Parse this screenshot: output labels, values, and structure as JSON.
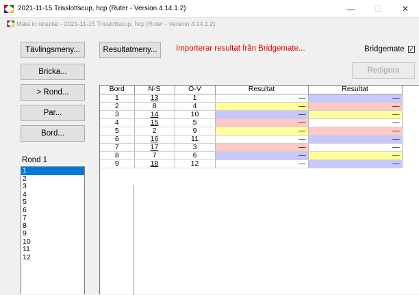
{
  "window": {
    "title": "2021-11-15  Trisslottscup, hcp  (Ruter - Version 4.14.1.2)",
    "minimize_glyph": "—",
    "maximize_glyph": "☐",
    "close_glyph": "✕"
  },
  "subwindow": {
    "title": "Mata in resultat - 2021-11-15  Trisslottscup, hcp  (Ruter - Version 4.14.1.2)"
  },
  "sidebar": {
    "buttons": [
      {
        "label": "Tävlingsmeny..."
      },
      {
        "label": "Bricka..."
      },
      {
        "label": ">   Rond..."
      },
      {
        "label": "Par..."
      },
      {
        "label": "Bord..."
      }
    ],
    "rond_label": "Rond 1",
    "rond_items": [
      "1",
      "2",
      "3",
      "4",
      "5",
      "6",
      "7",
      "8",
      "9",
      "10",
      "11",
      "12"
    ],
    "selected_rond": "1"
  },
  "toolbar": {
    "resultatmeny_label": "Resultatmeny...",
    "import_status": "Importerar resultat från Bridgemate...",
    "bridgemate_label": "Bridgemate",
    "bridgemate_checked": true,
    "bridgemate_check_glyph": "✓",
    "redigera_label": "Redigera"
  },
  "table": {
    "headers": [
      "Bord",
      "N-S",
      "Ö-V",
      "Resultat",
      "Resultat"
    ],
    "rows": [
      {
        "bord": "1",
        "ns": "13",
        "ov": "1",
        "r1": "—",
        "r2": "—",
        "c1": "white",
        "c2": "blue"
      },
      {
        "bord": "2",
        "ns": "8",
        "ov": "4",
        "r1": "—",
        "r2": "—",
        "c1": "yellow",
        "c2": "pink"
      },
      {
        "bord": "3",
        "ns": "14",
        "ov": "10",
        "r1": "—",
        "r2": "—",
        "c1": "blue",
        "c2": "yellow"
      },
      {
        "bord": "4",
        "ns": "15",
        "ov": "5",
        "r1": "—",
        "r2": "—",
        "c1": "pink",
        "c2": "white"
      },
      {
        "bord": "5",
        "ns": "2",
        "ov": "9",
        "r1": "—",
        "r2": "—",
        "c1": "yellow",
        "c2": "pink"
      },
      {
        "bord": "6",
        "ns": "16",
        "ov": "11",
        "r1": "—",
        "r2": "—",
        "c1": "white",
        "c2": "blue"
      },
      {
        "bord": "7",
        "ns": "17",
        "ov": "3",
        "r1": "—",
        "r2": "—",
        "c1": "pink",
        "c2": "white"
      },
      {
        "bord": "8",
        "ns": "7",
        "ov": "6",
        "r1": "—",
        "r2": "—",
        "c1": "blue",
        "c2": "yellow"
      },
      {
        "bord": "9",
        "ns": "18",
        "ov": "12",
        "r1": "—",
        "r2": "—",
        "c1": "white",
        "c2": "blue"
      }
    ],
    "underlined_ns": [
      "13",
      "14",
      "15",
      "16",
      "17",
      "18"
    ]
  },
  "colors": {
    "yellow": "#ffff99",
    "pink": "#ffc8c8",
    "blue": "#c8c8ff",
    "white": "#ffffff",
    "import_status": "#e00000",
    "selection": "#0078d7"
  }
}
